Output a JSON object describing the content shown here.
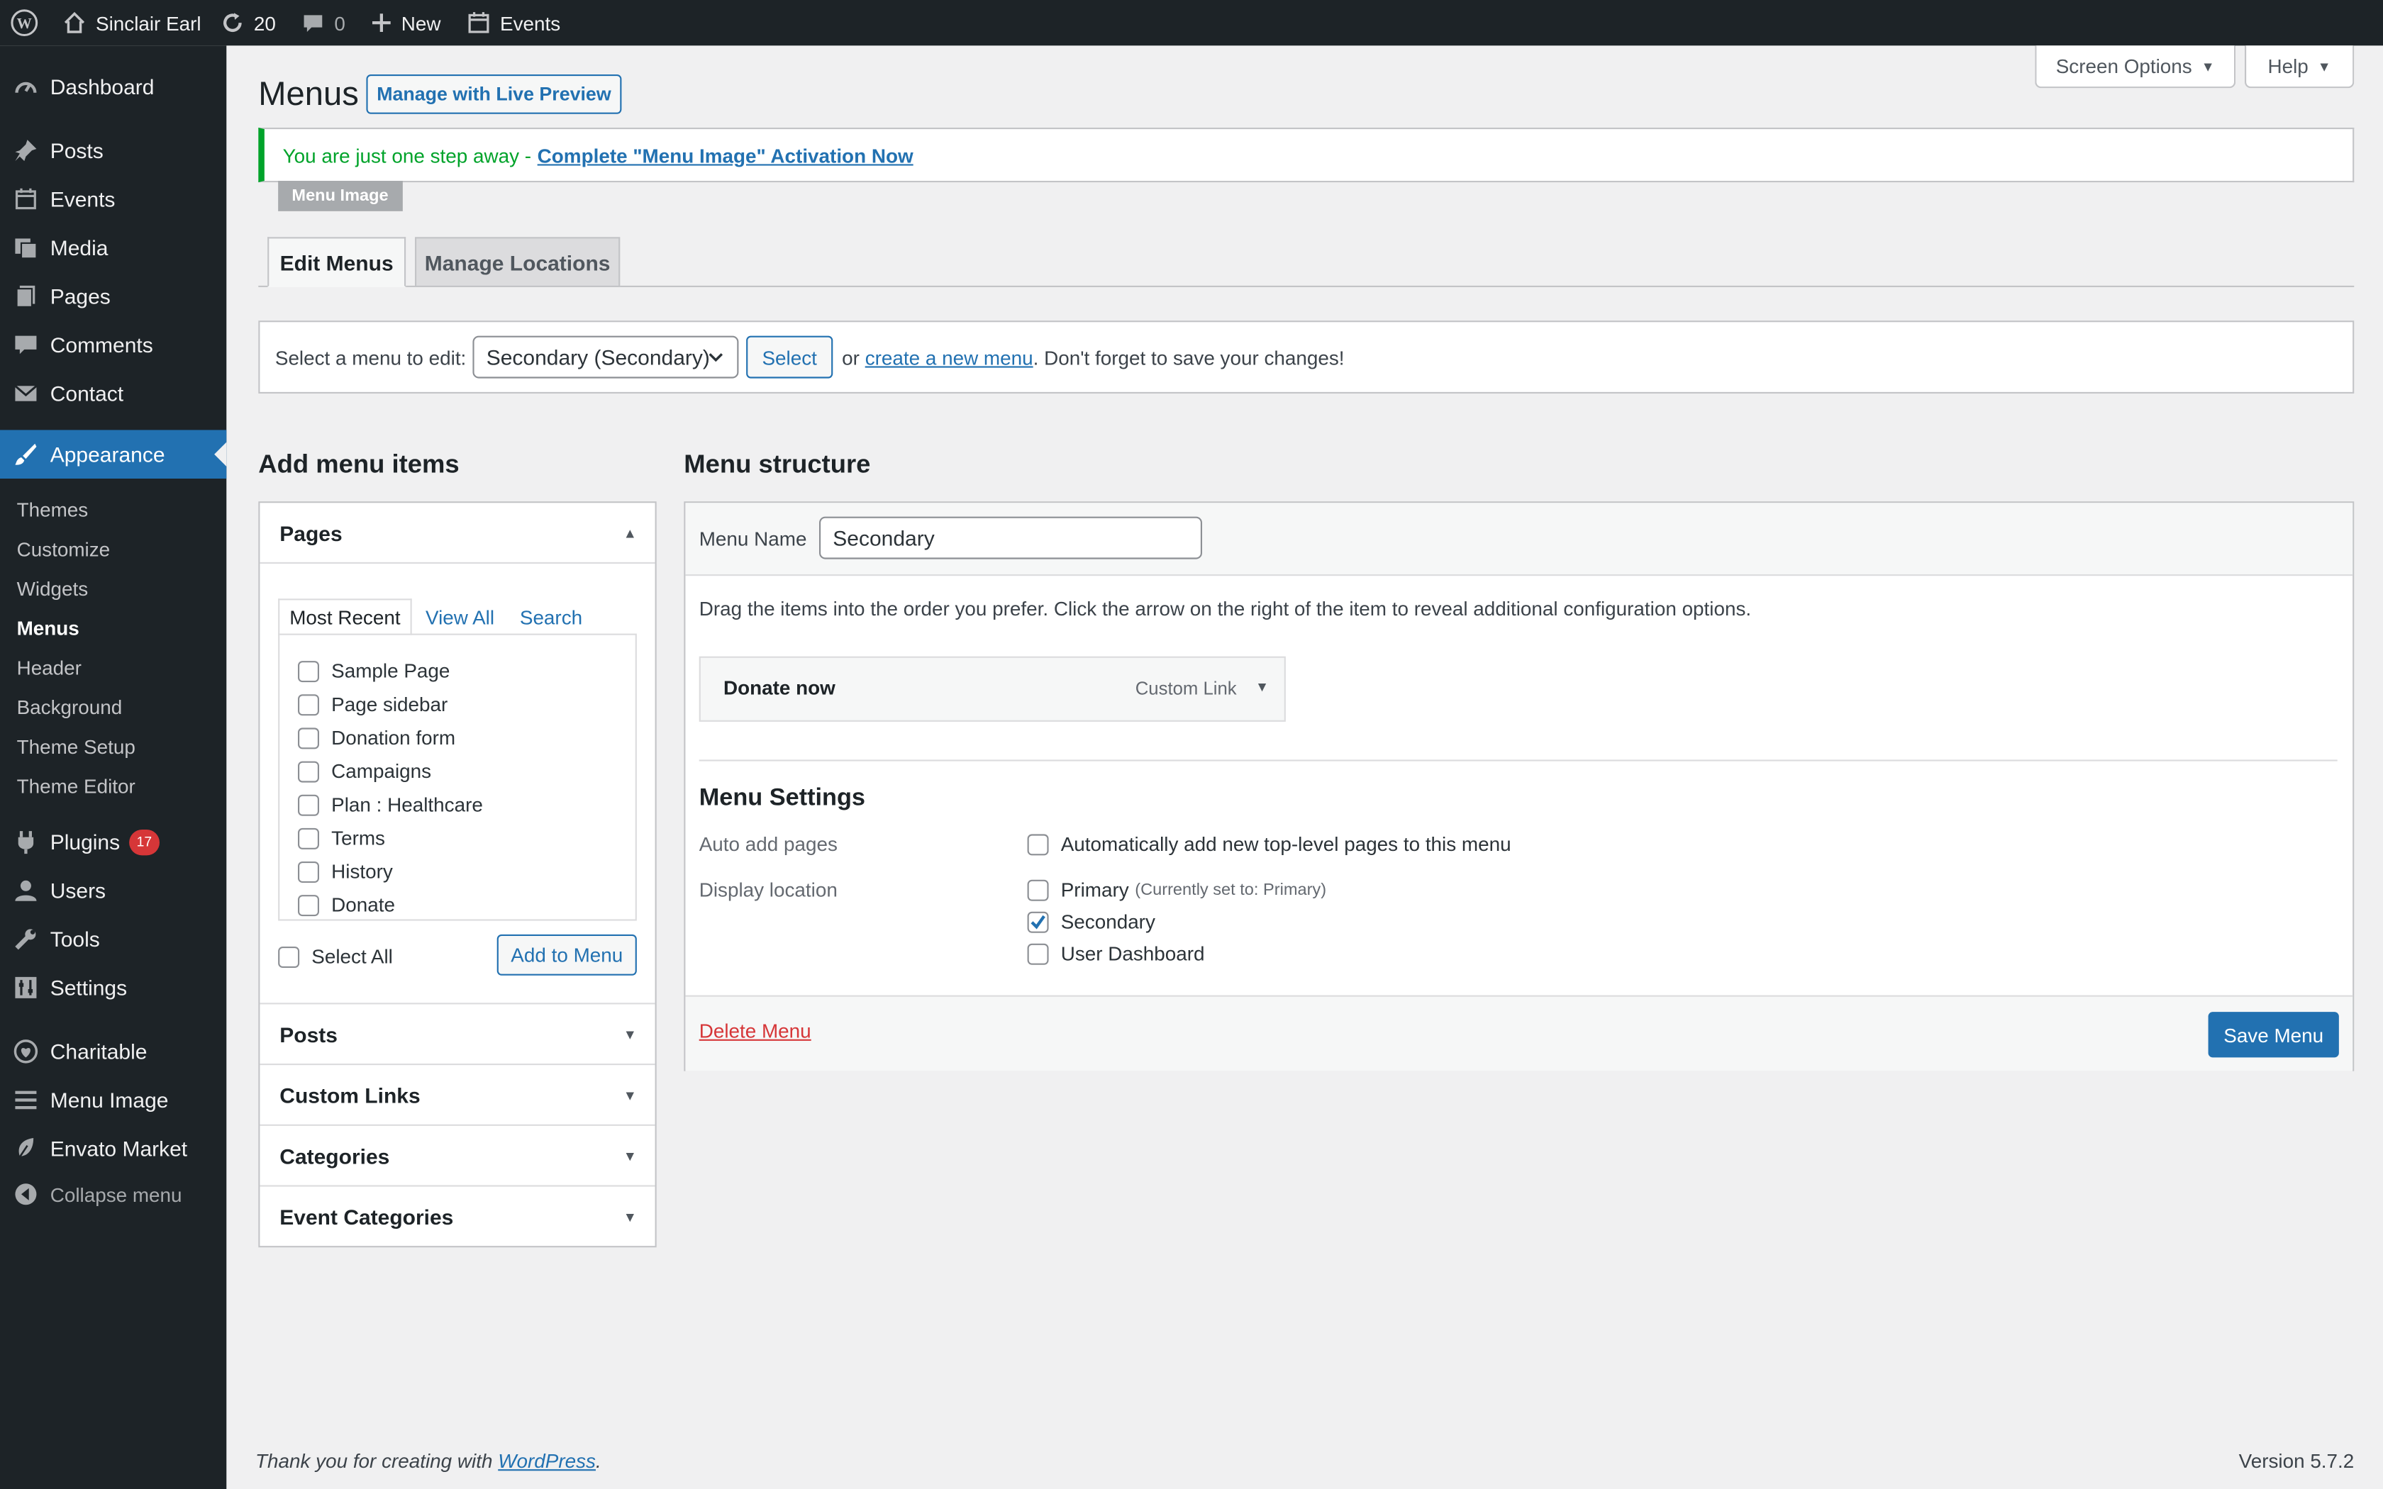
{
  "admin_bar": {
    "site_name": "Sinclair Earl",
    "updates_count": "20",
    "comments_count": "0",
    "new_label": "New",
    "events_label": "Events"
  },
  "sidebar": {
    "items": [
      {
        "label": "Dashboard",
        "icon": "dashboard-icon"
      },
      {
        "label": "Posts",
        "icon": "pin-icon"
      },
      {
        "label": "Events",
        "icon": "calendar-icon"
      },
      {
        "label": "Media",
        "icon": "media-icon"
      },
      {
        "label": "Pages",
        "icon": "page-icon"
      },
      {
        "label": "Comments",
        "icon": "comment-icon"
      },
      {
        "label": "Contact",
        "icon": "mail-icon"
      },
      {
        "label": "Appearance",
        "icon": "brush-icon"
      }
    ],
    "submenu": [
      "Themes",
      "Customize",
      "Widgets",
      "Menus",
      "Header",
      "Background",
      "Theme Setup",
      "Theme Editor"
    ],
    "items_lower": [
      {
        "label": "Plugins",
        "icon": "plugin-icon",
        "badge": "17"
      },
      {
        "label": "Users",
        "icon": "user-icon"
      },
      {
        "label": "Tools",
        "icon": "wrench-icon"
      },
      {
        "label": "Settings",
        "icon": "settings-icon"
      },
      {
        "label": "Charitable",
        "icon": "heart-icon"
      },
      {
        "label": "Menu Image",
        "icon": "menu-lines-icon"
      },
      {
        "label": "Envato Market",
        "icon": "leaf-icon"
      }
    ],
    "collapse_label": "Collapse menu"
  },
  "header": {
    "title": "Menus",
    "live_preview": "Manage with Live Preview",
    "screen_options": "Screen Options",
    "help": "Help"
  },
  "notice": {
    "text": "You are just one step away -",
    "link": "Complete \"Menu Image\" Activation Now",
    "tag": "Menu Image"
  },
  "tabs": {
    "edit": "Edit Menus",
    "manage": "Manage Locations"
  },
  "select_menu": {
    "label": "Select a menu to edit:",
    "selected": "Secondary (Secondary)",
    "button": "Select",
    "or": "or",
    "create_link": "create a new menu",
    "suffix": ". Don't forget to save your changes!"
  },
  "add_items": {
    "title": "Add menu items",
    "pages_title": "Pages",
    "subtabs": [
      "Most Recent",
      "View All",
      "Search"
    ],
    "pages": [
      "Sample Page",
      "Page sidebar",
      "Donation form",
      "Campaigns",
      "Plan : Healthcare",
      "Terms",
      "History",
      "Donate"
    ],
    "select_all": "Select All",
    "add_button": "Add to Menu",
    "sections": [
      "Posts",
      "Custom Links",
      "Categories",
      "Event Categories"
    ]
  },
  "structure": {
    "title": "Menu structure",
    "name_label": "Menu Name",
    "name_value": "Secondary",
    "instructions": "Drag the items into the order you prefer. Click the arrow on the right of the item to reveal additional configuration options.",
    "item_title": "Donate now",
    "item_type": "Custom Link",
    "settings_title": "Menu Settings",
    "auto_add_label": "Auto add pages",
    "auto_add_text": "Automatically add new top-level pages to this menu",
    "display_label": "Display location",
    "locations": [
      {
        "label": "Primary",
        "note": "(Currently set to: Primary)",
        "checked": false
      },
      {
        "label": "Secondary",
        "note": "",
        "checked": true
      },
      {
        "label": "User Dashboard",
        "note": "",
        "checked": false
      }
    ],
    "delete": "Delete Menu",
    "save": "Save Menu"
  },
  "footer": {
    "thanks": "Thank you for creating with",
    "wp_link": "WordPress",
    "period": ".",
    "version": "Version 5.7.2"
  },
  "colors": {
    "accent": "#2271b1",
    "sidebar": "#1d2327",
    "notice_green": "#00a32a",
    "badge": "#d63638"
  }
}
